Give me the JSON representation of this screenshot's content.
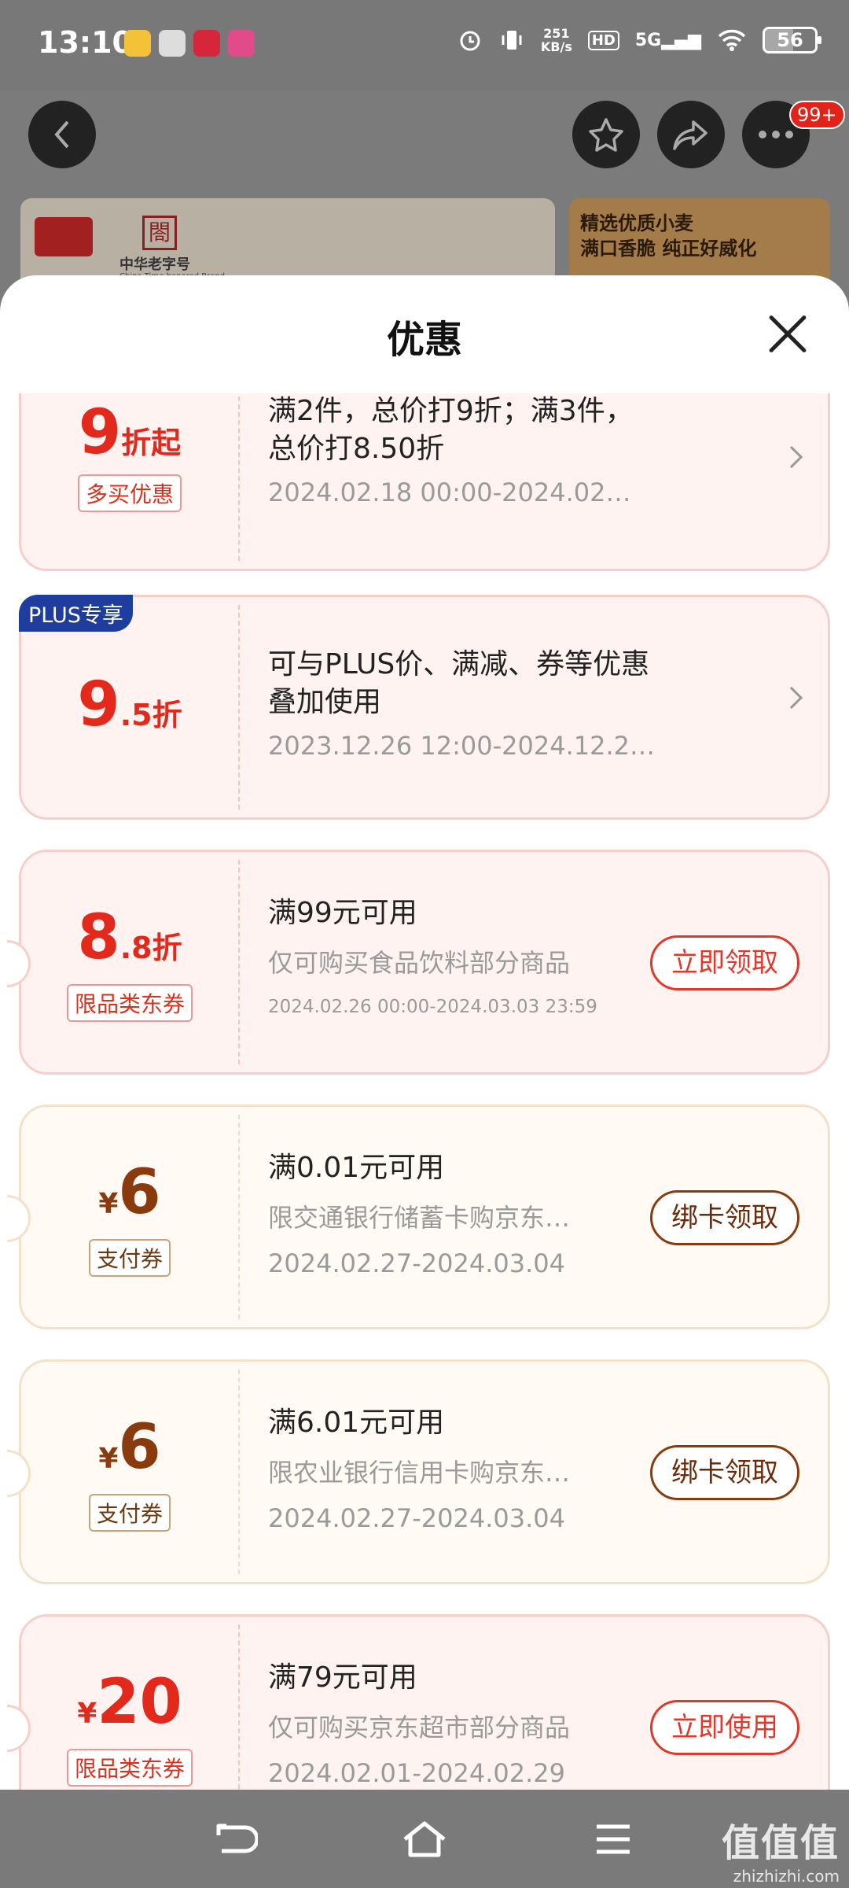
{
  "status_bar": {
    "time": "13:10",
    "net_speed_value": "251",
    "net_speed_unit": "KB/s",
    "hd": "HD",
    "signal": "5G",
    "battery": "56"
  },
  "header": {
    "more_badge": "99+"
  },
  "banner": {
    "brand_text": "中华老字号",
    "brand_en": "China Time-honored Brand",
    "promo_line1": "精选优质小麦",
    "promo_line2": "满口香脆 纯正好威化"
  },
  "sheet": {
    "title": "优惠"
  },
  "coupons": [
    {
      "amount_big": "9",
      "amount_small": "折起",
      "tag": "多买优惠",
      "line1": "满2件，总价打9折；满3件，总价打8.50折",
      "line3": "2024.02.18 00:00-2024.02.2…"
    },
    {
      "badge": "PLUS专享",
      "amount_big": "9",
      "amount_small": ".5折",
      "line1": "可与PLUS价、满减、券等优惠叠加使用",
      "line3": "2023.12.26 12:00-2024.12.2…"
    },
    {
      "amount_big": "8",
      "amount_small": ".8折",
      "tag": "限品类东券",
      "line1": "满99元可用",
      "line2": "仅可购买食品饮料部分商品",
      "line3": "2024.02.26 00:00-2024.03.03 23:59",
      "action": "立即领取"
    },
    {
      "currency": "¥",
      "amount_big": "6",
      "tag": "支付券",
      "line1": "满0.01元可用",
      "line2": "限交通银行储蓄卡购京东…",
      "line3": "2024.02.27-2024.03.04",
      "action": "绑卡领取"
    },
    {
      "currency": "¥",
      "amount_big": "6",
      "tag": "支付券",
      "line1": "满6.01元可用",
      "line2": "限农业银行信用卡购京东…",
      "line3": "2024.02.27-2024.03.04",
      "action": "绑卡领取"
    },
    {
      "currency": "¥",
      "amount_big": "20",
      "tag": "限品类东券",
      "line1": "满79元可用",
      "line2": "仅可购买京东超市部分商品",
      "line3": "2024.02.01-2024.02.29",
      "action": "立即使用"
    }
  ],
  "watermark": {
    "text": "值值值",
    "domain": "zhizhizhi.com"
  }
}
